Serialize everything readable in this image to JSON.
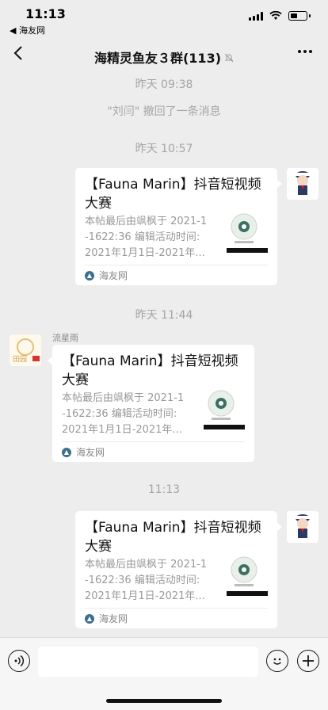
{
  "status_bar": {
    "time": "11:13",
    "back_app": "◀ 海友网"
  },
  "nav": {
    "back_icon": "chevron-left-icon",
    "title": "海精灵鱼友３群(113)",
    "mute_icon": "bell-off-icon",
    "more_icon": "more-icon"
  },
  "chat": {
    "stamp_1": "昨天 09:38",
    "recall_notice": "\"刘闫\" 撤回了一条消息",
    "stamp_2": "昨天 10:57",
    "stamp_3": "昨天 11:44",
    "stamp_4": "11:13",
    "sender_name": "流星雨",
    "messages": [
      {
        "title": "【Fauna Marin】抖音短视频大赛",
        "desc_lines": [
          "本帖最后由飒枫于 2021-1",
          "-1622:36 编辑活动时间:",
          "2021年1月1日-2021年..."
        ],
        "source": "海友网"
      },
      {
        "title": "【Fauna Marin】抖音短视频大赛",
        "desc_lines": [
          "本帖最后由飒枫于 2021-1",
          "-1622:36 编辑活动时间:",
          "2021年1月1日-2021年..."
        ],
        "source": "海友网"
      },
      {
        "title": "【Fauna Marin】抖音短视频大赛",
        "desc_lines": [
          "本帖最后由飒枫于 2021-1",
          "-1622:36 编辑活动时间:",
          "2021年1月1日-2021年..."
        ],
        "source": "海友网"
      }
    ]
  },
  "input_bar": {
    "voice_icon": "voice-icon",
    "emoji_icon": "emoji-icon",
    "plus_icon": "plus-icon",
    "input_value": ""
  }
}
